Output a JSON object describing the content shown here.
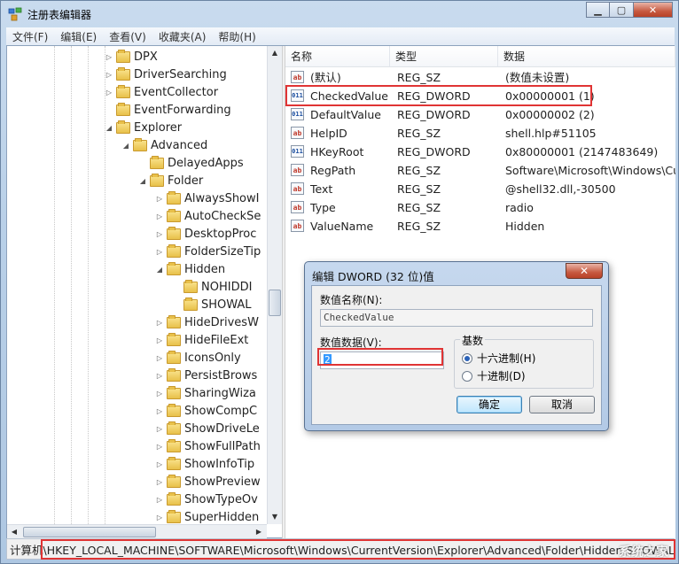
{
  "window": {
    "title": "注册表编辑器",
    "controls": [
      "▁",
      "▢",
      "✕"
    ]
  },
  "menu": [
    "文件(F)",
    "编辑(E)",
    "查看(V)",
    "收藏夹(A)",
    "帮助(H)"
  ],
  "tree": [
    {
      "label": "DPX",
      "arrow": "▷"
    },
    {
      "label": "DriverSearching",
      "arrow": "▷"
    },
    {
      "label": "EventCollector",
      "arrow": "▷"
    },
    {
      "label": "EventForwarding",
      "arrow": ""
    },
    {
      "label": "Explorer",
      "arrow": "◢"
    },
    {
      "label": "Advanced",
      "arrow": "◢"
    },
    {
      "label": "DelayedApps",
      "arrow": ""
    },
    {
      "label": "Folder",
      "arrow": "◢"
    },
    {
      "label": "AlwaysShowI",
      "arrow": "▷"
    },
    {
      "label": "AutoCheckSe",
      "arrow": "▷"
    },
    {
      "label": "DesktopProc",
      "arrow": "▷"
    },
    {
      "label": "FolderSizeTip",
      "arrow": "▷"
    },
    {
      "label": "Hidden",
      "arrow": "◢"
    },
    {
      "label": "NOHIDDI",
      "arrow": ""
    },
    {
      "label": "SHOWAL",
      "arrow": ""
    },
    {
      "label": "HideDrivesW",
      "arrow": "▷"
    },
    {
      "label": "HideFileExt",
      "arrow": "▷"
    },
    {
      "label": "IconsOnly",
      "arrow": "▷"
    },
    {
      "label": "PersistBrows",
      "arrow": "▷"
    },
    {
      "label": "SharingWiza",
      "arrow": "▷"
    },
    {
      "label": "ShowCompC",
      "arrow": "▷"
    },
    {
      "label": "ShowDriveLe",
      "arrow": "▷"
    },
    {
      "label": "ShowFullPath",
      "arrow": "▷"
    },
    {
      "label": "ShowInfoTip",
      "arrow": "▷"
    },
    {
      "label": "ShowPreview",
      "arrow": "▷"
    },
    {
      "label": "ShowTypeOv",
      "arrow": "▷"
    },
    {
      "label": "SuperHidden",
      "arrow": "▷"
    }
  ],
  "list": {
    "headers": [
      "名称",
      "类型",
      "数据"
    ],
    "rows": [
      {
        "icon": "ab",
        "name": "(默认)",
        "type": "REG_SZ",
        "data": "(数值未设置)"
      },
      {
        "icon": "011",
        "name": "CheckedValue",
        "type": "REG_DWORD",
        "data": "0x00000001 (1)"
      },
      {
        "icon": "011",
        "name": "DefaultValue",
        "type": "REG_DWORD",
        "data": "0x00000002 (2)"
      },
      {
        "icon": "ab",
        "name": "HelpID",
        "type": "REG_SZ",
        "data": "shell.hlp#51105"
      },
      {
        "icon": "011",
        "name": "HKeyRoot",
        "type": "REG_DWORD",
        "data": "0x80000001 (2147483649)"
      },
      {
        "icon": "ab",
        "name": "RegPath",
        "type": "REG_SZ",
        "data": "Software\\Microsoft\\Windows\\Cu"
      },
      {
        "icon": "ab",
        "name": "Text",
        "type": "REG_SZ",
        "data": "@shell32.dll,-30500"
      },
      {
        "icon": "ab",
        "name": "Type",
        "type": "REG_SZ",
        "data": "radio"
      },
      {
        "icon": "ab",
        "name": "ValueName",
        "type": "REG_SZ",
        "data": "Hidden"
      }
    ]
  },
  "status": "计算机\\HKEY_LOCAL_MACHINE\\SOFTWARE\\Microsoft\\Windows\\CurrentVersion\\Explorer\\Advanced\\Folder\\Hidden\\SHOWALL",
  "dialog": {
    "title": "编辑 DWORD (32 位)值",
    "close": "✕",
    "name_label": "数值名称(N):",
    "name_value": "CheckedValue",
    "data_label": "数值数据(V):",
    "data_value": "2",
    "base_label": "基数",
    "hex_label": "十六进制(H)",
    "dec_label": "十进制(D)",
    "ok": "确定",
    "cancel": "取消"
  },
  "watermark": "系统之家",
  "colors": {
    "highlight": "#e03434",
    "selection": "#3399ff"
  }
}
